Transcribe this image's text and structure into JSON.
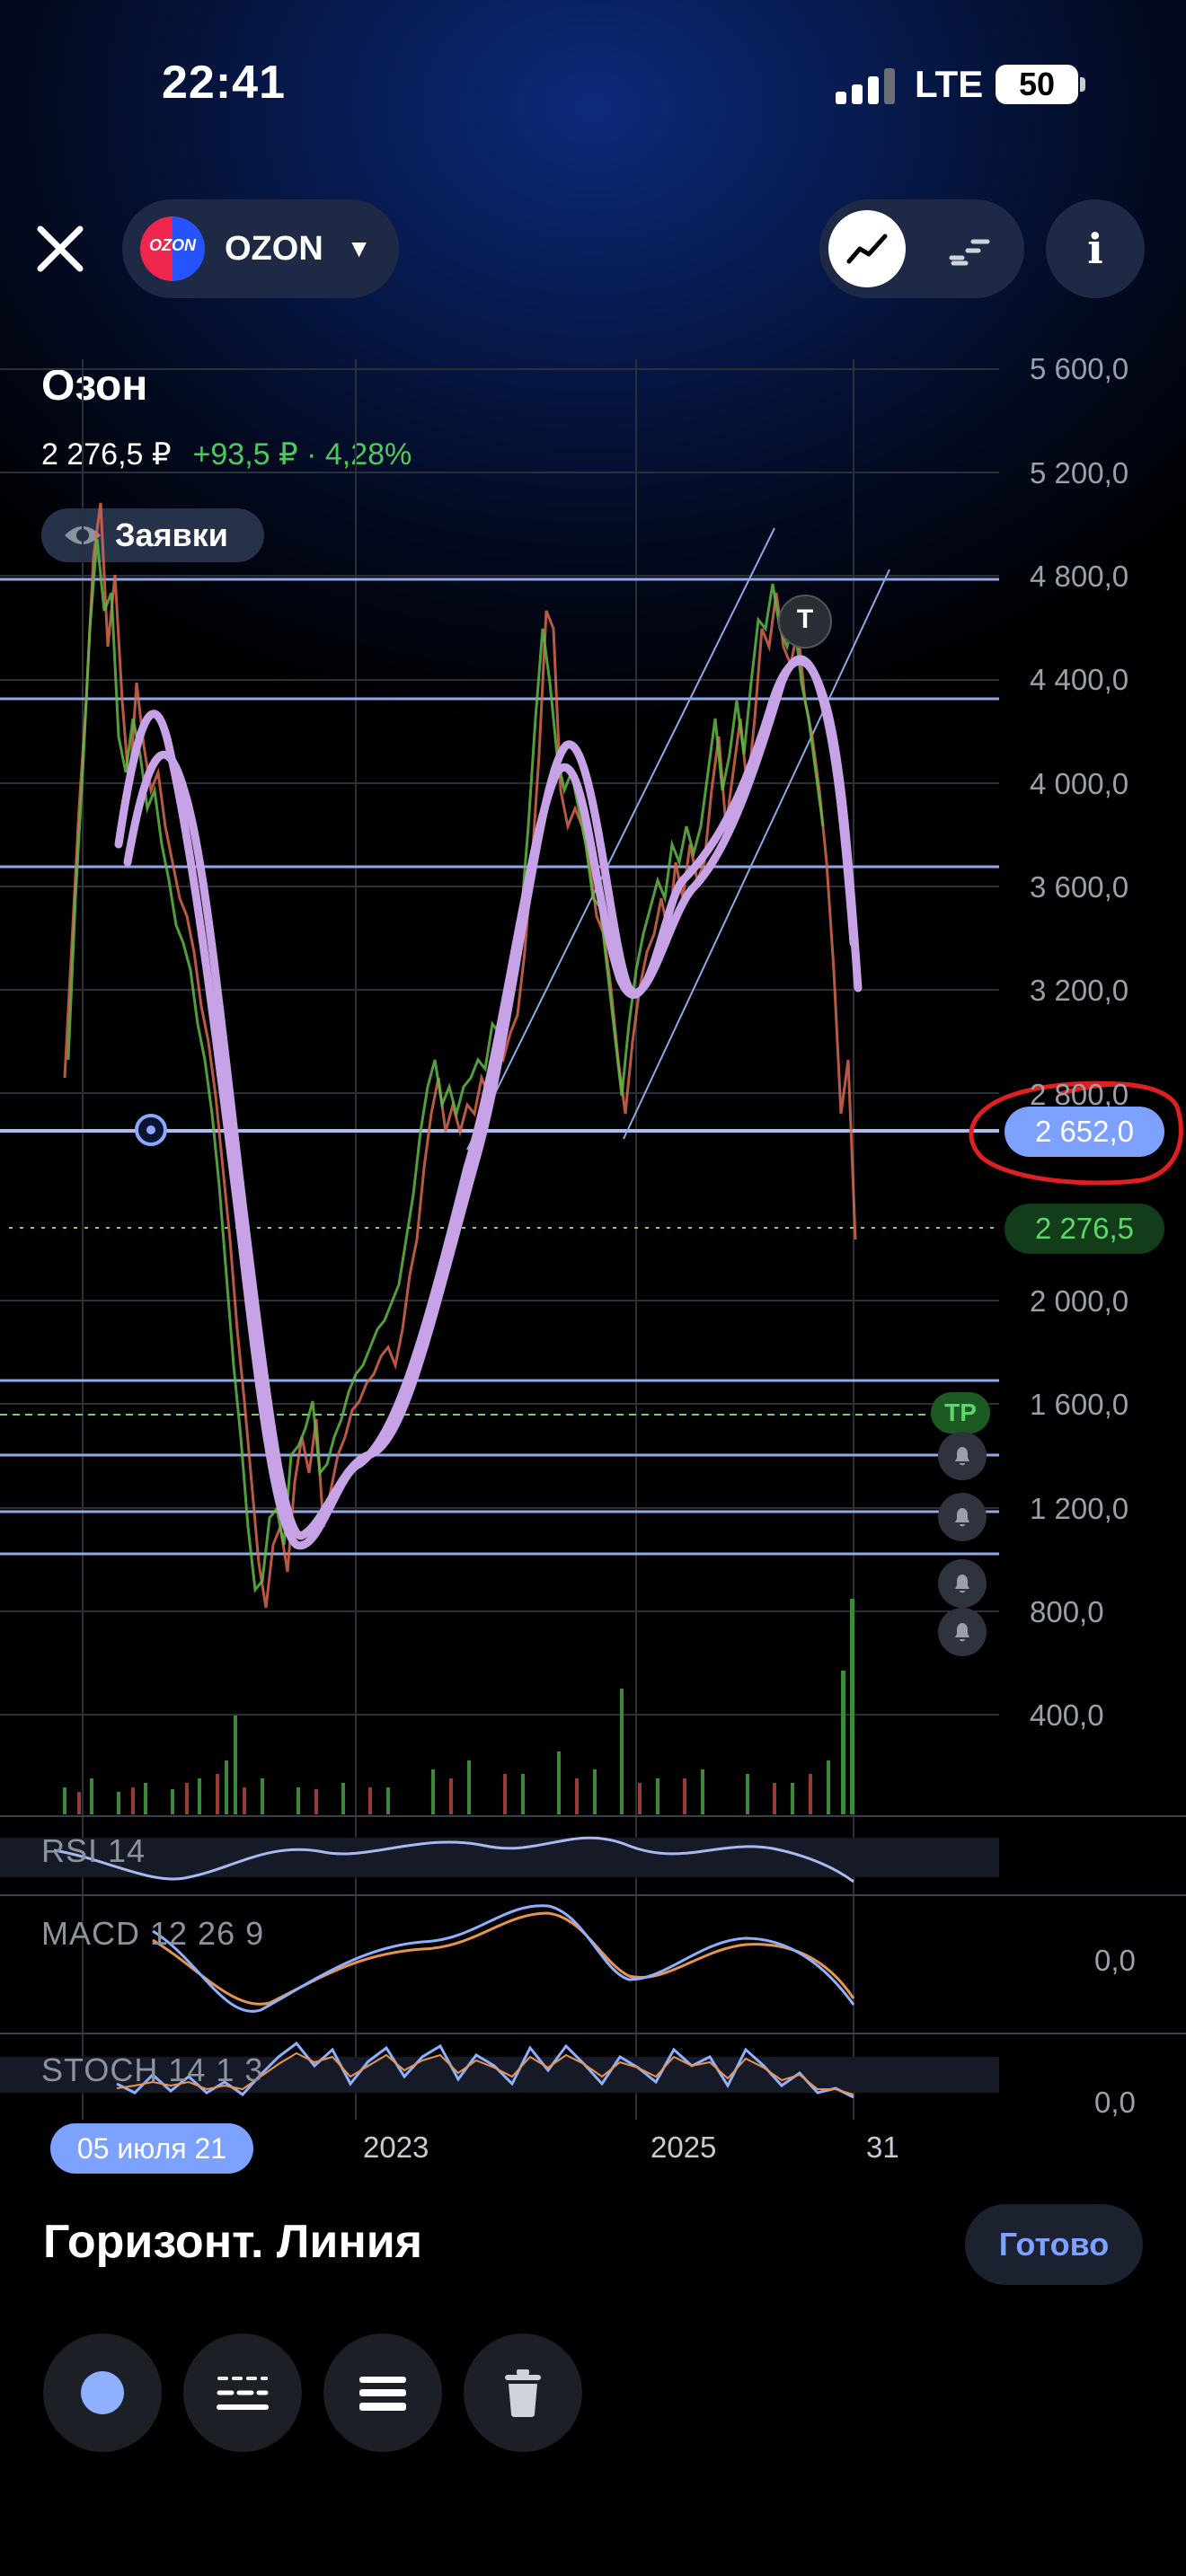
{
  "status_bar": {
    "time": "22:41",
    "network": "LTE",
    "battery": "50"
  },
  "header": {
    "ticker": "OZON",
    "logo_text": "OZON"
  },
  "instrument": {
    "name": "Озон",
    "price": "2 276,5 ₽",
    "change": "+93,5 ₽ · 4,28%",
    "orders_label": "Заявки"
  },
  "price_axis": [
    "5 600,0",
    "5 200,0",
    "4 800,0",
    "4 400,0",
    "4 000,0",
    "3 600,0",
    "3 200,0",
    "2 800,0",
    "2 000,0",
    "1 600,0",
    "1 200,0",
    "800,0",
    "400,0"
  ],
  "tags": {
    "line_price": "2 652,0",
    "current_price": "2 276,5",
    "tp": "TP",
    "trade_marker": "T"
  },
  "indicators": {
    "rsi": "RSI 14",
    "macd": "MACD 12 26 9",
    "stoch": "STOCH 14 1 3",
    "macd_zero": "0,0",
    "stoch_zero": "0,0"
  },
  "time_axis": {
    "selected_date": "05 июля 21",
    "labels": [
      "2023",
      "2025",
      "31"
    ]
  },
  "tool": {
    "title": "Горизонт. Линия",
    "done": "Готово"
  },
  "colors": {
    "accent": "#7da1ff",
    "up": "#4cc95c",
    "down": "#e2574c",
    "ma": "#c7a2e6",
    "annotation": "#e02020"
  }
}
